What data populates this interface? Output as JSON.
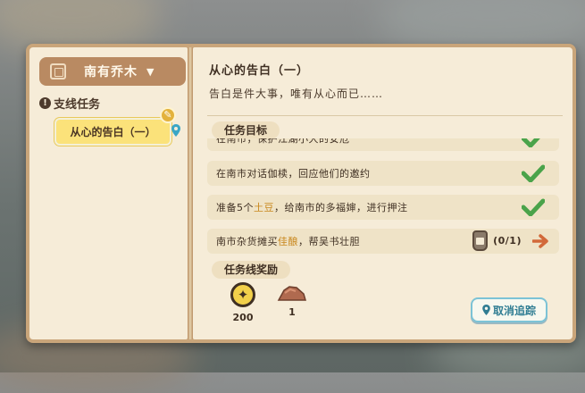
{
  "sidebar": {
    "region_label": "南有乔木",
    "category_label": "支线任务",
    "quests": [
      {
        "label": "从心的告白（一）",
        "selected": true
      }
    ]
  },
  "quest": {
    "title": "从心的告白（一）",
    "description": "告白是件大事，唯有从心而已……",
    "objectives_label": "任务目标",
    "objectives": [
      {
        "text": "在南市，保护江湖小大的安危",
        "done": true
      },
      {
        "text": "在南市对话伽椟，回应他们的邀约",
        "done": true
      },
      {
        "pre": "准备5个",
        "highlight": "土豆",
        "post": "，给南市的多福婶，进行押注",
        "done": true
      },
      {
        "pre": "南市杂货摊买",
        "highlight": "佳酿",
        "post": "，帮吴书壮胆",
        "done": false,
        "progress": "(0/1)"
      }
    ],
    "rewards_label": "任务线奖励",
    "rewards": [
      {
        "icon": "coin-icon",
        "value": "200"
      },
      {
        "icon": "ore-icon",
        "value": "1"
      }
    ],
    "untrack_label": "取消追踪"
  },
  "colors": {
    "highlight": "#c8861b",
    "check": "#4aa34a",
    "arrow": "#d2693a",
    "button_text": "#2f7d93"
  }
}
